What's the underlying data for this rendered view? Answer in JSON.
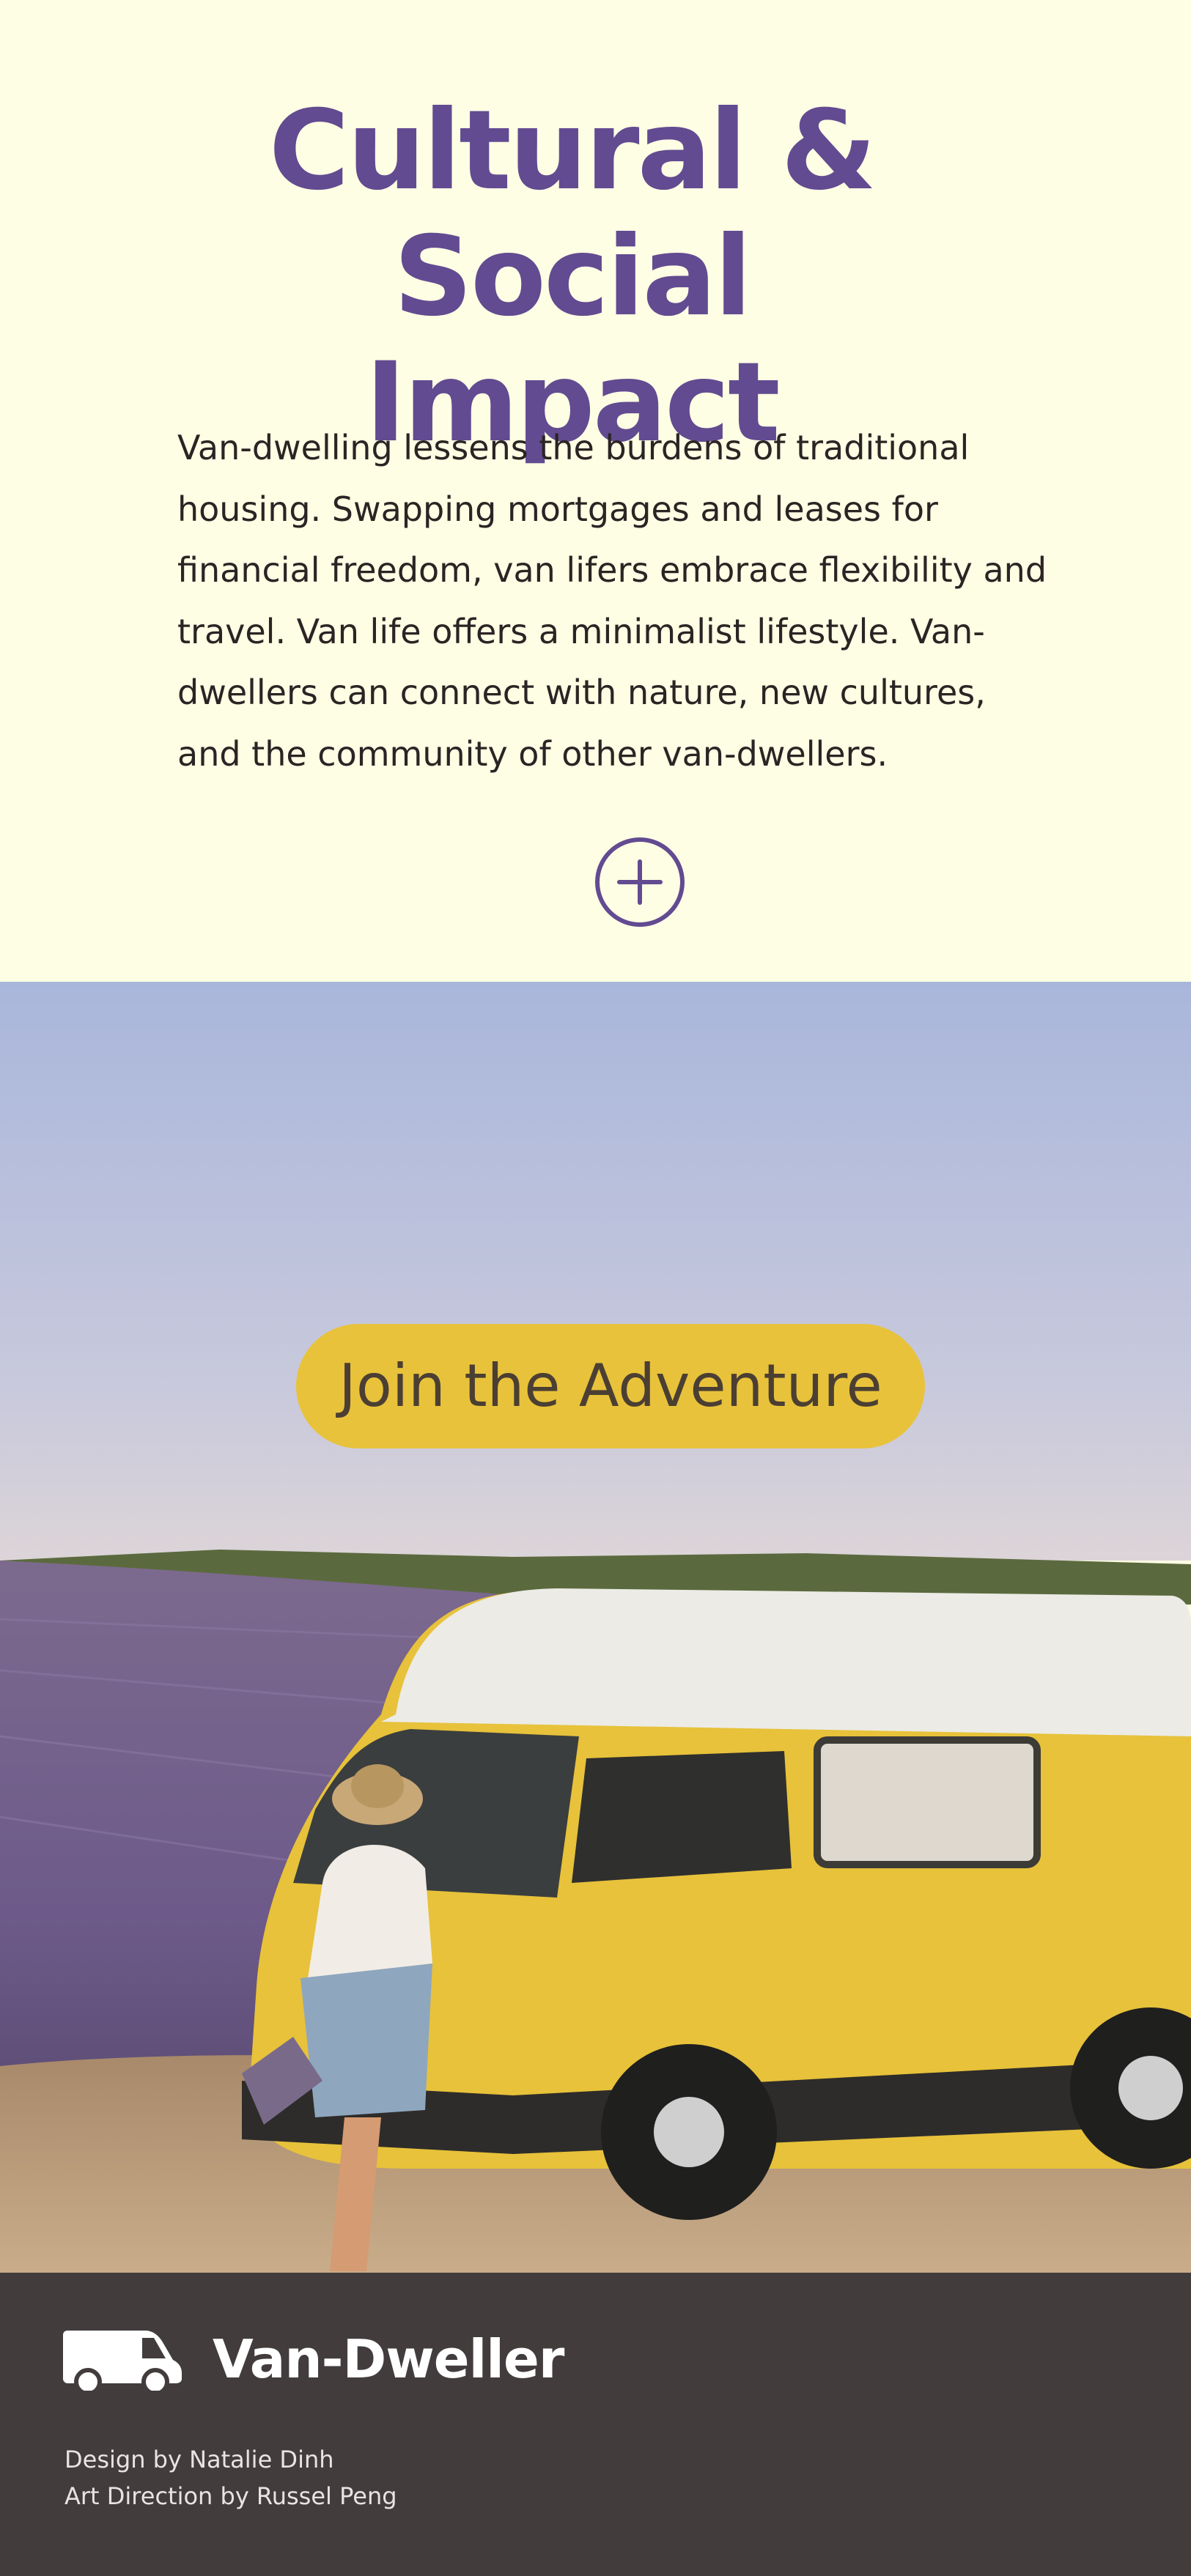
{
  "section": {
    "title": "Cultural & Social Impact",
    "body": "Van-dwelling lessens the burdens of traditional housing. Swapping mortgages and leases for financial freedom, van lifers embrace flexibility and travel. Van life offers a minimalist lifestyle. Van-dwellers can connect with nature, new cultures, and the community of other van-dwellers.",
    "expand_icon": "plus-circle-icon"
  },
  "hero": {
    "cta_label": "Join the Adventure",
    "image_subject": "yellow-van-lavender-field"
  },
  "footer": {
    "logo_icon": "van-icon",
    "brand": "Van-Dweller",
    "credits": [
      "Design by Natalie Dinh",
      "Art Direction by Russel Peng"
    ]
  },
  "colors": {
    "background": "#fefee4",
    "accent_purple": "#624b91",
    "cta_yellow": "#e8c23a",
    "footer_bg": "#423c3d"
  }
}
